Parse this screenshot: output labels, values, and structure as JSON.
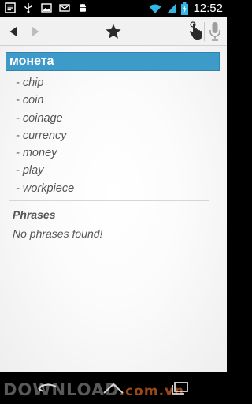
{
  "status_bar": {
    "time": "12:52",
    "left_icons": [
      "text-icon",
      "usb-icon",
      "image-icon",
      "mail-icon",
      "android-icon"
    ],
    "right_icons": [
      "wifi-icon",
      "signal-icon",
      "battery-icon"
    ]
  },
  "action_bar": {
    "icons": [
      "back-arrow-icon",
      "forward-arrow-icon",
      "star-icon",
      "touch-hand-icon",
      "microphone-icon"
    ]
  },
  "entry": {
    "word": "монета",
    "translations": [
      "- chip",
      "- coin",
      "- coinage",
      "- currency",
      "- money",
      "- play",
      "- workpiece"
    ]
  },
  "phrases": {
    "title": "Phrases",
    "empty_text": "No phrases found!"
  },
  "nav_bar": {
    "icons": [
      "nav-back-icon",
      "nav-home-icon",
      "nav-recent-icon"
    ]
  },
  "watermark": {
    "main": "DOWNLOAD",
    "suffix": ".com.vn"
  },
  "colors": {
    "header_bg": "#3d9ac9",
    "text": "#555555",
    "action_bar_bg": "#f1f1f1"
  }
}
